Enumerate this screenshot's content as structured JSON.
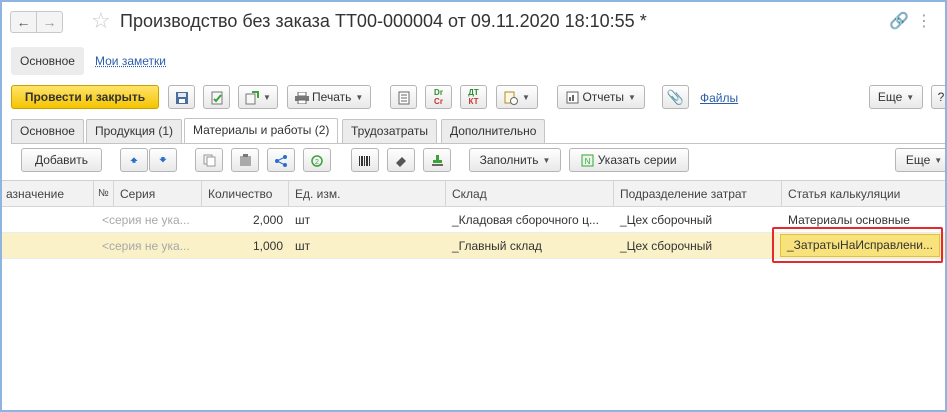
{
  "window": {
    "title": "Производство без заказа ТТ00-000004 от 09.11.2020 18:10:55 *"
  },
  "top_tabs": {
    "main": "Основное",
    "notes": "Мои заметки"
  },
  "toolbar": {
    "post_close": "Провести и закрыть",
    "print": "Печать",
    "reports": "Отчеты",
    "files": "Файлы",
    "more": "Еще",
    "help": "?",
    "dr_top": "Dr",
    "dr_bottom": "Cr",
    "dt_top": "ДТ",
    "dt_bottom": "КТ"
  },
  "section_tabs": [
    "Основное",
    "Продукция (1)",
    "Материалы и работы (2)",
    "Трудозатраты",
    "Дополнительно"
  ],
  "table_toolbar": {
    "add": "Добавить",
    "fill": "Заполнить",
    "specify_series": "Указать серии",
    "more": "Еще"
  },
  "table": {
    "columns": [
      "азначение",
      "№",
      "Серия",
      "Количество",
      "Ед. изм.",
      "Склад",
      "Подразделение затрат",
      "Статья калькуляции"
    ],
    "rows": [
      {
        "series": "<серия не ука...",
        "qty": "2,000",
        "unit": "шт",
        "warehouse": "_Кладовая сборочного ц...",
        "division": "_Цех сборочный",
        "cost_item": "Материалы основные"
      },
      {
        "series": "<серия не ука...",
        "qty": "1,000",
        "unit": "шт",
        "warehouse": "_Главный склад",
        "division": "_Цех сборочный",
        "cost_item": "_ЗатратыНаИсправлени..."
      }
    ]
  },
  "colors": {
    "primary_button": "#f4c400",
    "selected_row": "#fbf1c8",
    "edit_cell": "#f8e27b",
    "highlight": "#e8282a",
    "link": "#2b5ea7"
  }
}
